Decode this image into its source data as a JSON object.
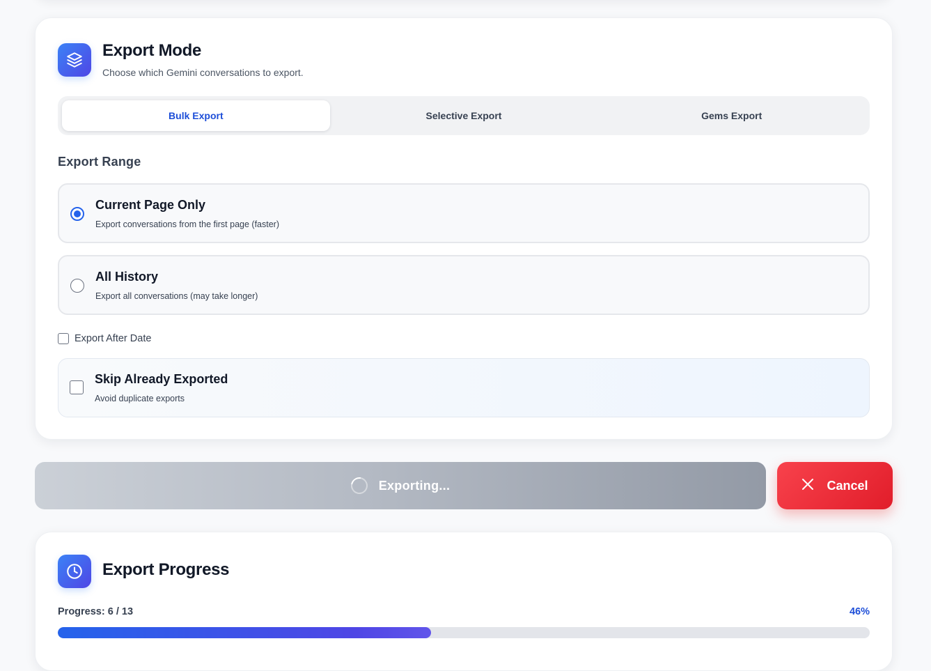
{
  "mode_card": {
    "title": "Export Mode",
    "subtitle": "Choose which Gemini conversations to export.",
    "icon": "layers-icon"
  },
  "tabs": [
    {
      "label": "Bulk Export",
      "active": true
    },
    {
      "label": "Selective Export",
      "active": false
    },
    {
      "label": "Gems Export",
      "active": false
    }
  ],
  "export_range": {
    "label": "Export Range",
    "options": [
      {
        "title": "Current Page Only",
        "description": "Export conversations from the first page (faster)",
        "selected": true
      },
      {
        "title": "All History",
        "description": "Export all conversations (may take longer)",
        "selected": false
      }
    ]
  },
  "export_after_date": {
    "label": "Export After Date",
    "checked": false
  },
  "skip_exported": {
    "title": "Skip Already Exported",
    "description": "Avoid duplicate exports",
    "checked": false
  },
  "actions": {
    "export_label": "Exporting...",
    "cancel_label": "Cancel"
  },
  "progress_card": {
    "title": "Export Progress",
    "icon": "clock-icon",
    "label_prefix": "Progress:",
    "count": "6 / 13",
    "percent_label": "46%",
    "percent": 46
  },
  "colors": {
    "accent": "#2563eb",
    "accent_text": "#1d4ed8",
    "cancel": "#ef4444"
  }
}
